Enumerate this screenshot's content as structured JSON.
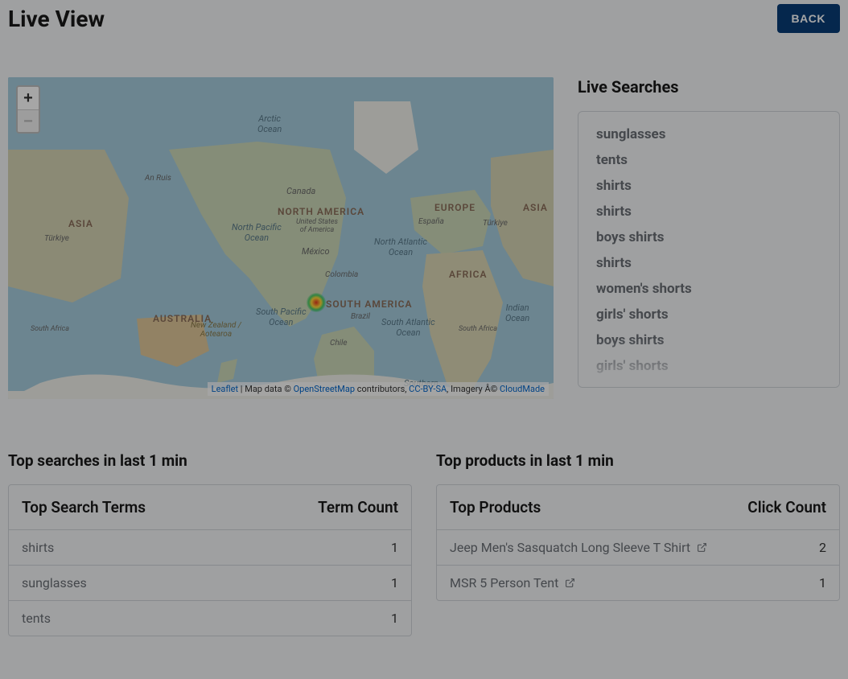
{
  "header": {
    "title": "Live View",
    "back_label": "BACK"
  },
  "map": {
    "zoom_in": "+",
    "zoom_out": "−",
    "attribution": {
      "leaflet": "Leaflet",
      "sep1": " | Map data © ",
      "osm": "OpenStreetMap",
      "sep2": " contributors, ",
      "ccbysa": "CC-BY-SA",
      "sep3": ", Imagery Â© ",
      "cloudmade": "CloudMade"
    },
    "labels": {
      "arctic": "Arctic\nOcean",
      "north_pacific": "North Pacific\nOcean",
      "north_atlantic": "North Atlantic\nOcean",
      "south_pacific": "South Pacific\nOcean",
      "south_atlantic": "South Atlantic\nOcean",
      "indian": "Indian\nOcean",
      "southern": "Southern",
      "north_america": "NORTH AMERICA",
      "south_america": "SOUTH AMERICA",
      "europe": "EUROPE",
      "africa": "AFRICA",
      "asia": "ASIA",
      "asia2": "ASIA",
      "australia": "AUSTRALIA",
      "canada": "Canada",
      "united_states": "United States\nof America",
      "mexico": "México",
      "brazil": "Brazil",
      "colombia": "Colombia",
      "chile": "Chile",
      "an_ruis": "An Ruis",
      "espana": "España",
      "turkiye": "Türkiye",
      "turkiye2": "Türkiye",
      "nz": "New Zealand /\nAotearoa",
      "south_africa": "South Africa",
      "south_africa_2": "South Africa"
    }
  },
  "live_searches": {
    "title": "Live Searches",
    "items": [
      "sunglasses",
      "tents",
      "shirts",
      "shirts",
      "boys shirts",
      "shirts",
      "women's shorts",
      "girls' shorts",
      "boys shirts",
      "girls' shorts"
    ]
  },
  "top_searches": {
    "title": "Top searches in last 1 min",
    "col_term": "Top Search Terms",
    "col_count": "Term Count",
    "rows": [
      {
        "term": "shirts",
        "count": "1"
      },
      {
        "term": "sunglasses",
        "count": "1"
      },
      {
        "term": "tents",
        "count": "1"
      }
    ]
  },
  "top_products": {
    "title": "Top products in last 1 min",
    "col_product": "Top Products",
    "col_count": "Click Count",
    "rows": [
      {
        "product": "Jeep Men's Sasquatch Long Sleeve T Shirt",
        "count": "2"
      },
      {
        "product": "MSR 5 Person Tent",
        "count": "1"
      }
    ]
  }
}
